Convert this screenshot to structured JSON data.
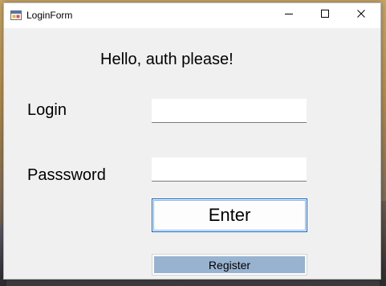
{
  "window": {
    "title": "LoginForm"
  },
  "form": {
    "heading": "Hello, auth please!",
    "login_label": "Login",
    "login_value": "",
    "password_label": "Passsword",
    "password_value": "",
    "enter_label": "Enter",
    "register_label": "Register"
  },
  "titlebar_buttons": {
    "minimize": "minimize-icon",
    "maximize": "maximize-icon",
    "close": "close-icon"
  },
  "colors": {
    "window_bg": "#f0f0f0",
    "titlebar_bg": "#ffffff",
    "enter_border": "#0a64c8",
    "register_bg": "#98b3d0"
  }
}
